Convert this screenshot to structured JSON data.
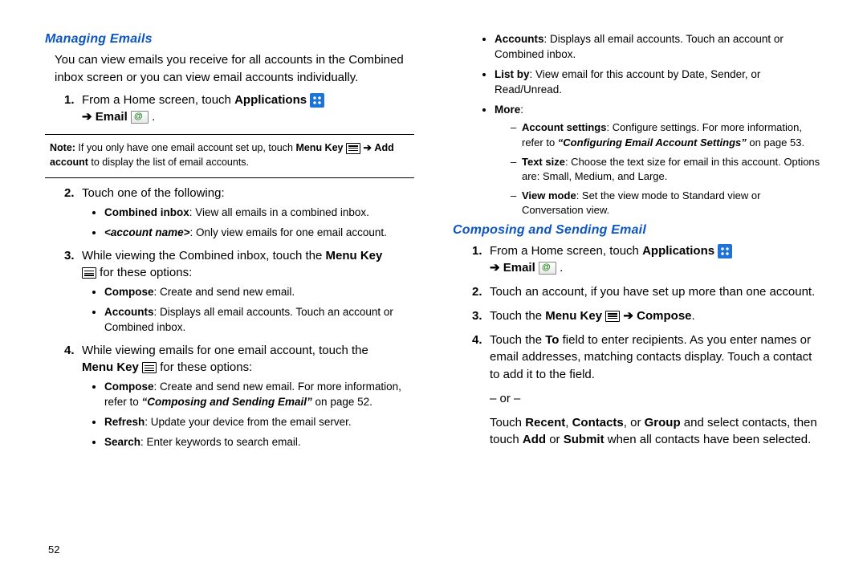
{
  "pageNumber": "52",
  "arrow": "➔",
  "left": {
    "section": "Managing Emails",
    "intro": "You can view emails you receive for all accounts in the Combined inbox screen or you can view email accounts individually.",
    "step1_a": "From a Home screen, touch ",
    "step1_apps": "Applications",
    "step1_email": "Email",
    "note_head": "Note: ",
    "note_a": "If you only have one email account set up, touch ",
    "note_menu": "Menu Key",
    "note_b": "Add account",
    "note_c": " to display the list of email accounts.",
    "step2": "Touch one of the following:",
    "b2a_h": "Combined inbox",
    "b2a_t": ": View all emails in a combined inbox.",
    "b2b_h": "<account name>",
    "b2b_t": ": Only view emails for one email account.",
    "step3_a": "While viewing the Combined inbox, touch the ",
    "step3_menu": "Menu Key",
    "step3_b": " for these options:",
    "b3a_h": "Compose",
    "b3a_t": ": Create and send new email.",
    "b3b_h": "Accounts",
    "b3b_t": ": Displays all email accounts. Touch an account or Combined inbox.",
    "step4_a": "While viewing emails for one email account, touch the ",
    "step4_menu": "Menu Key",
    "step4_b": " for these options:",
    "b4a_h": "Compose",
    "b4a_t": ": Create and send new email. For more information, refer to ",
    "b4a_ref": "“Composing and Sending Email”",
    "b4a_pg": "  on page 52.",
    "b4b_h": "Refresh",
    "b4b_t": ": Update your device from the email server.",
    "b4c_h": "Search",
    "b4c_t": ": Enter keywords to search email."
  },
  "right": {
    "ba_h": "Accounts",
    "ba_t": ": Displays all email accounts. Touch an account or Combined inbox.",
    "bb_h": "List by",
    "bb_t": ": View email for this account by Date, Sender, or Read/Unread.",
    "bc_h": "More",
    "bc_t": ":",
    "d1_h": "Account settings",
    "d1_t": ": Configure settings. For more information, refer to ",
    "d1_ref": "“Configuring Email Account Settings”",
    "d1_pg": "  on page 53.",
    "d2_h": "Text size",
    "d2_t": ": Choose the text size for email in this account. Options are: Small, Medium, and Large.",
    "d3_h": "View mode",
    "d3_t": ": Set the view mode to Standard view or Conversation view.",
    "section": "Composing and Sending Email",
    "s1_a": "From a Home screen, touch ",
    "s1_apps": "Applications",
    "s1_email": "Email",
    "s2": "Touch an account, if you have set up more than one account.",
    "s3_a": "Touch the ",
    "s3_menu": "Menu Key",
    "s3_compose": "Compose",
    "s4_a": "Touch the ",
    "s4_to": "To",
    "s4_b": " field to enter recipients. As you enter names or email addresses, matching contacts display. Touch a contact to add it to the field.",
    "s4_or": "– or –",
    "s4_c": "Touch ",
    "s4_recent": "Recent",
    "s4_contacts": "Contacts",
    "s4_group": "Group",
    "s4_d": " and select contacts, then touch ",
    "s4_add": "Add",
    "s4_submit": "Submit",
    "s4_e": " when all contacts have been selected."
  }
}
